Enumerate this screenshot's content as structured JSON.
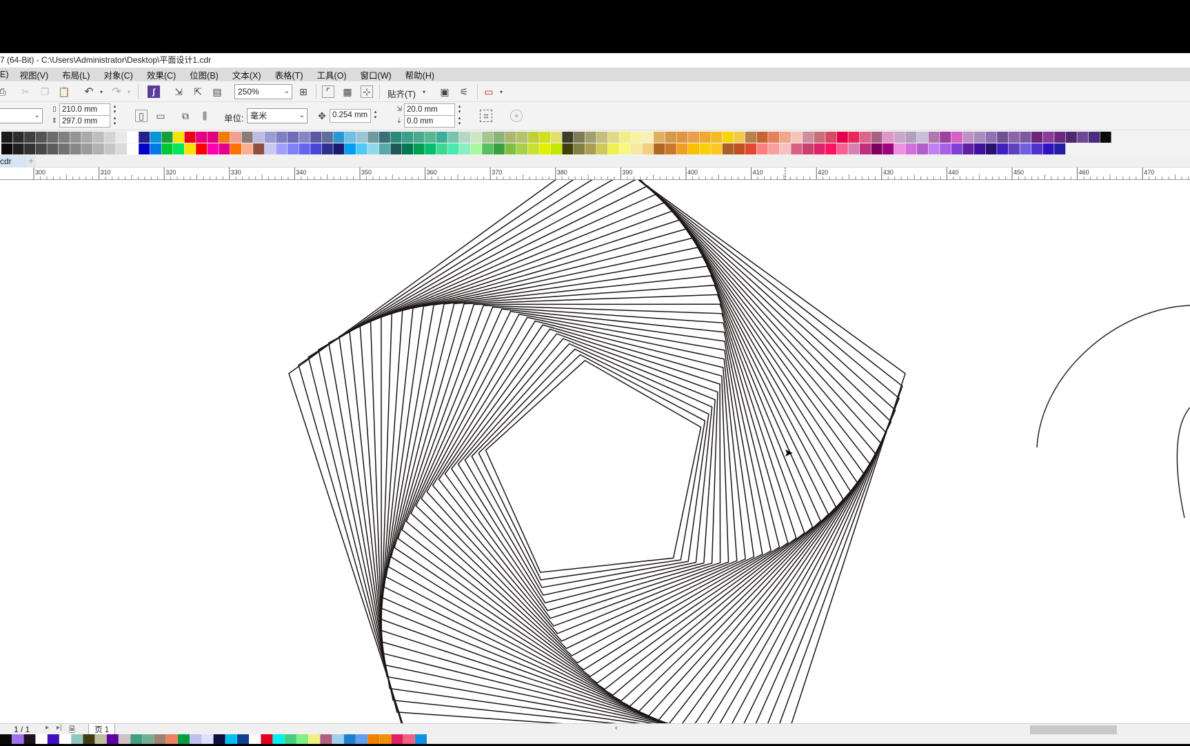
{
  "window": {
    "title": "7 (64-Bit) - C:\\Users\\Administrator\\Desktop\\平面设计1.cdr"
  },
  "menu": [
    "E)",
    "视图(V)",
    "布局(L)",
    "对象(C)",
    "效果(C)",
    "位图(B)",
    "文本(X)",
    "表格(T)",
    "工具(O)",
    "窗口(W)",
    "帮助(H)"
  ],
  "toolbar": {
    "zoom": "250%",
    "snap_label": "贴齐(T)"
  },
  "property_bar": {
    "page_width": "210.0 mm",
    "page_height": "297.0 mm",
    "unit_label": "单位:",
    "unit_value": "毫米",
    "nudge": "0.254 mm",
    "dup_x": "20.0 mm",
    "dup_y": "0.0 mm"
  },
  "document_tab": "cdr",
  "ruler_ticks": [
    "300",
    "310",
    "320",
    "330",
    "340",
    "350",
    "360",
    "370",
    "380",
    "390",
    "400",
    "410",
    "420",
    "430",
    "440",
    "450",
    "460",
    "470"
  ],
  "status": {
    "page_count": "1 / 1",
    "page_tab": "页 1"
  },
  "colors": {
    "palette_row1": [
      "#1a1a1a",
      "#2c2c2c",
      "#404040",
      "#555555",
      "#6b6b6b",
      "#808080",
      "#959595",
      "#aaaaaa",
      "#bfbfbf",
      "#d4d4d4",
      "#e9e9e9",
      "#ffffff",
      "#23238e",
      "#0a94d8",
      "#1a9e3c",
      "#f7e400",
      "#e8001c",
      "#e4007f",
      "#e1007f",
      "#f07d00",
      "#f2a094",
      "#8a7a78",
      "#bcbce0",
      "#9b9bd6",
      "#7f7fc6",
      "#6d6db8",
      "#8585c2",
      "#5a5aa4",
      "#5e6e98",
      "#2a98d6",
      "#6ec0e4",
      "#98c6d4",
      "#6e9a9e",
      "#3a6e7a",
      "#2a8a7a",
      "#38a08c",
      "#4caa8c",
      "#58b690",
      "#3eae9a",
      "#78c2b0",
      "#b4d8c4",
      "#cfe4c2",
      "#a6c690",
      "#8cb478",
      "#aab870",
      "#b6c26a",
      "#c0d03a",
      "#cfe01e",
      "#e4e070",
      "#3c3c28",
      "#7c7c5a",
      "#a0a070",
      "#c4c07c",
      "#e0da86",
      "#f4ee86",
      "#f8f4a0",
      "#f8f0b8",
      "#e0b060",
      "#d49a46",
      "#e0963c",
      "#e8a04a",
      "#f0a830",
      "#f4bc24",
      "#fad40a",
      "#f4c84c",
      "#b8824e",
      "#c86432",
      "#e4805a",
      "#f4a68c",
      "#f4c4b4",
      "#d08ca0",
      "#c87078",
      "#d84a62",
      "#e4004a",
      "#e8285a",
      "#e06488",
      "#a86082",
      "#e096c4",
      "#c8a8c8",
      "#b0a0b8",
      "#c8c0d8",
      "#b078b0",
      "#a040a0",
      "#d860c0",
      "#c090c8",
      "#a88cbc",
      "#9070b0",
      "#705090",
      "#8c64a8",
      "#7e58a0",
      "#6c2878",
      "#8a3c98",
      "#6a2a80",
      "#502870",
      "#6c4898",
      "#4a2c80",
      "#0a0a0a"
    ],
    "palette_row2": [
      "#0a0a0a",
      "#1f1f1f",
      "#333333",
      "#484848",
      "#5d5d5d",
      "#727272",
      "#878787",
      "#9c9c9c",
      "#b1b1b1",
      "#c6c6c6",
      "#dbdbdb",
      "#ffffff",
      "#0000c8",
      "#0078e8",
      "#00c832",
      "#00e85a",
      "#ffe000",
      "#ff0000",
      "#ff00b0",
      "#e4008c",
      "#ff7000",
      "#f8b090",
      "#905040",
      "#c8c8f0",
      "#a0a0f8",
      "#8080f8",
      "#6464f0",
      "#4848d8",
      "#303090",
      "#1a1a70",
      "#00a0f0",
      "#50c8f8",
      "#90d8f0",
      "#58a8a8",
      "#205858",
      "#007850",
      "#00a050",
      "#00c070",
      "#40d890",
      "#48e8b0",
      "#88f0c0",
      "#a8f8a0",
      "#58c060",
      "#38a040",
      "#80c040",
      "#a8d048",
      "#c8e030",
      "#e0f000",
      "#c0e800",
      "#404008",
      "#808040",
      "#a8a050",
      "#d0c858",
      "#f0f050",
      "#f8f880",
      "#f8e8a0",
      "#f0d080",
      "#b06820",
      "#c87828",
      "#f0a020",
      "#f8c000",
      "#f8d000",
      "#ffc820",
      "#a86028",
      "#c05020",
      "#e04830",
      "#ff8080",
      "#f8a0a0",
      "#f8c0c0",
      "#d86080",
      "#c84070",
      "#e0206c",
      "#ff1060",
      "#f86090",
      "#d880b0",
      "#c03080",
      "#800060",
      "#a00080",
      "#f090e0",
      "#d070d8",
      "#b060c8",
      "#c080f0",
      "#a860e8",
      "#8040d8",
      "#6020a0",
      "#4010a0",
      "#2a1070",
      "#4020c0",
      "#6040c0",
      "#7060e0",
      "#5030d0",
      "#3010c0",
      "#2020a0"
    ],
    "bottom_palette": [
      "#0a0a0a",
      "#a070f0",
      "#201020",
      "#ffffff",
      "#4010c0",
      "#ffffff",
      "#90c8c0",
      "#403c10",
      "#c0c0a0",
      "#6000a0",
      "#d0c0c8",
      "#40a080",
      "#70b090",
      "#a08070",
      "#f08060",
      "#00a040",
      "#c0c0f0",
      "#e0e0f8",
      "#101040",
      "#00c0f0",
      "#104090",
      "#ffffff",
      "#e00020",
      "#00f0f0",
      "#40d080",
      "#80f080",
      "#f0f080",
      "#b06080",
      "#a0d0f0",
      "#2080d0",
      "#60a0f0",
      "#f08000",
      "#f09000",
      "#e02060",
      "#f06080",
      "#1090e0"
    ]
  }
}
